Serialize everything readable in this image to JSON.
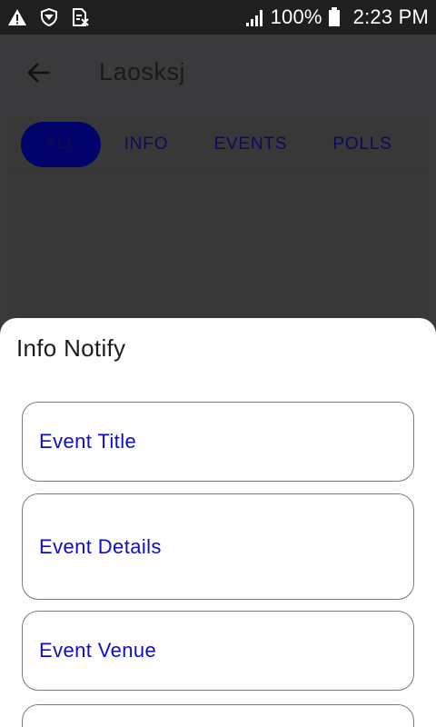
{
  "status_bar": {
    "battery": "100%",
    "time": "2:23 PM",
    "icons": [
      "warning-icon",
      "vpn-shield-icon",
      "sim-card-icon",
      "signal-icon",
      "battery-icon"
    ]
  },
  "app_bar": {
    "title": "Laosksj",
    "back_icon": "arrow-left-icon"
  },
  "tabs": [
    {
      "label": "ALL",
      "active": true
    },
    {
      "label": "INFO",
      "active": false
    },
    {
      "label": "EVENTS",
      "active": false
    },
    {
      "label": "POLLS",
      "active": false
    }
  ],
  "sheet": {
    "title": "Info Notify",
    "fields": [
      {
        "label": "Event Title"
      },
      {
        "label": "Event Details"
      },
      {
        "label": "Event Venue"
      },
      {
        "label": ""
      }
    ]
  },
  "colors": {
    "accent": "#0d0dcc",
    "active_tab": "#02026b",
    "scrim": "#3a3a3c",
    "status_bar": "#1f1f1f"
  }
}
